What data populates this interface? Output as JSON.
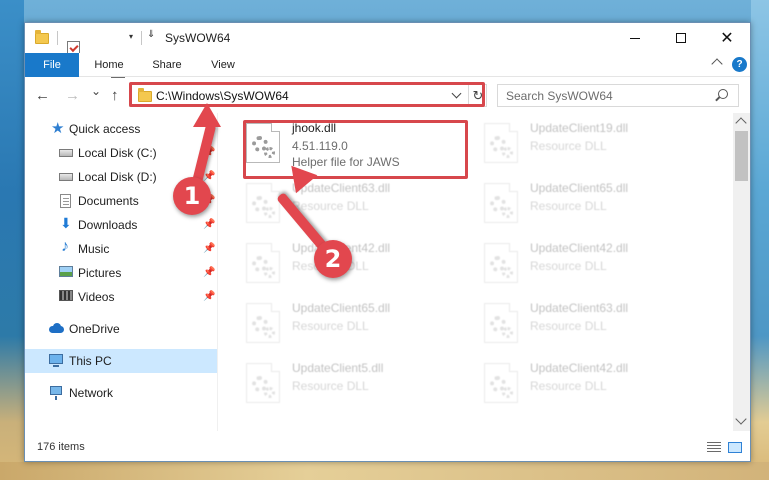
{
  "window": {
    "title": "SysWOW64",
    "controls": {
      "minimize": "",
      "maximize": "",
      "close": "✕"
    }
  },
  "ribbon": {
    "tabs": [
      "File",
      "Home",
      "Share",
      "View"
    ],
    "help": "?"
  },
  "navigation": {
    "back": "←",
    "forward": "→",
    "recent": "⌄",
    "up": "↑",
    "address": "C:\\Windows\\SysWOW64",
    "refresh": "↻",
    "search_placeholder": "Search SysWOW64"
  },
  "sidebar": {
    "items": [
      {
        "label": "Quick access",
        "icon": "star-icon",
        "pinned": false
      },
      {
        "label": "Local Disk (C:)",
        "icon": "disk-icon",
        "pinned": true
      },
      {
        "label": "Local Disk (D:)",
        "icon": "disk-icon",
        "pinned": true
      },
      {
        "label": "Documents",
        "icon": "document-icon",
        "pinned": true
      },
      {
        "label": "Downloads",
        "icon": "download-icon",
        "pinned": true
      },
      {
        "label": "Music",
        "icon": "music-icon",
        "pinned": true
      },
      {
        "label": "Pictures",
        "icon": "pictures-icon",
        "pinned": true
      },
      {
        "label": "Videos",
        "icon": "videos-icon",
        "pinned": true
      },
      {
        "label": "OneDrive",
        "icon": "onedrive-icon",
        "pinned": false
      },
      {
        "label": "This PC",
        "icon": "this-pc-icon",
        "pinned": false,
        "selected": true
      },
      {
        "label": "Network",
        "icon": "network-icon",
        "pinned": false
      }
    ],
    "pin_glyph": "📌"
  },
  "files": [
    {
      "name": "jhook.dll",
      "line2": "4.51.119.0",
      "line3": "Helper file for JAWS",
      "highlighted": true
    },
    {
      "name": "UpdateClient19.dll",
      "line2": "Resource DLL",
      "line3": ""
    },
    {
      "name": "UpdateClient63.dll",
      "line2": "Resource DLL",
      "line3": ""
    },
    {
      "name": "UpdateClient65.dll",
      "line2": "Resource DLL",
      "line3": ""
    },
    {
      "name": "UpdateClient42.dll",
      "line2": "Resource DLL",
      "line3": ""
    },
    {
      "name": "UpdateClient42.dll",
      "line2": "Resource DLL",
      "line3": ""
    },
    {
      "name": "UpdateClient65.dll",
      "line2": "Resource DLL",
      "line3": ""
    },
    {
      "name": "UpdateClient63.dll",
      "line2": "Resource DLL",
      "line3": ""
    },
    {
      "name": "UpdateClient5.dll",
      "line2": "Resource DLL",
      "line3": ""
    },
    {
      "name": "UpdateClient42.dll",
      "line2": "Resource DLL",
      "line3": ""
    }
  ],
  "status": {
    "item_count": "176 items"
  },
  "callouts": {
    "step1": "1",
    "step2": "2"
  },
  "colors": {
    "accent": "#1979ca",
    "highlight_red": "#d7474c",
    "selection": "#cce8ff"
  }
}
